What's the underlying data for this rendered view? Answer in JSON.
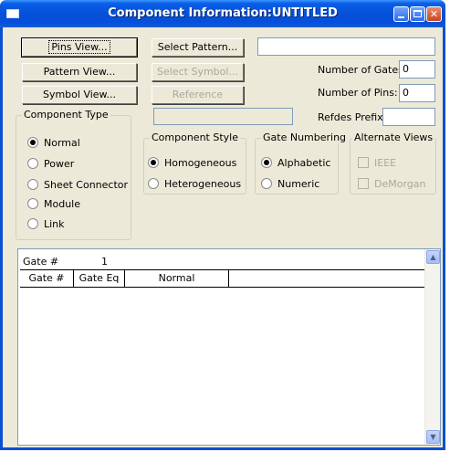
{
  "window": {
    "title": "Component Information:UNTITLED"
  },
  "buttons": {
    "pins_view": "Pins View...",
    "pattern_view": "Pattern View...",
    "symbol_view": "Symbol View...",
    "select_pattern": "Select Pattern...",
    "select_symbol": "Select Symbol...",
    "reference": "Reference"
  },
  "fields": {
    "top_right_value": "",
    "number_of_gates_label": "Number of Gates:",
    "number_of_gates_value": "0",
    "number_of_pins_label": "Number of Pins:",
    "number_of_pins_value": "0",
    "reference_value": "",
    "refdes_prefix_label": "Refdes Prefix:",
    "refdes_prefix_value": ""
  },
  "component_type": {
    "legend": "Component Type",
    "options": [
      "Normal",
      "Power",
      "Sheet Connector",
      "Module",
      "Link"
    ],
    "selected": "Normal"
  },
  "component_style": {
    "legend": "Component Style",
    "options": [
      "Homogeneous",
      "Heterogeneous"
    ],
    "selected": "Homogeneous"
  },
  "gate_numbering": {
    "legend": "Gate Numbering",
    "options": [
      "Alphabetic",
      "Numeric"
    ],
    "selected": "Alphabetic"
  },
  "alternate_views": {
    "legend": "Alternate Views",
    "options": [
      "IEEE",
      "DeMorgan"
    ]
  },
  "gate_panel": {
    "gate_label": "Gate #",
    "gate_value": "1",
    "columns": [
      "Gate #",
      "Gate Eq",
      "Normal",
      ""
    ]
  },
  "icons": {
    "scroll_up": "▲",
    "scroll_down": "▼"
  },
  "colors": {
    "titlebar": "#0451D8",
    "dialog_bg": "#ECE9D8",
    "close_button": "#C8461E"
  }
}
